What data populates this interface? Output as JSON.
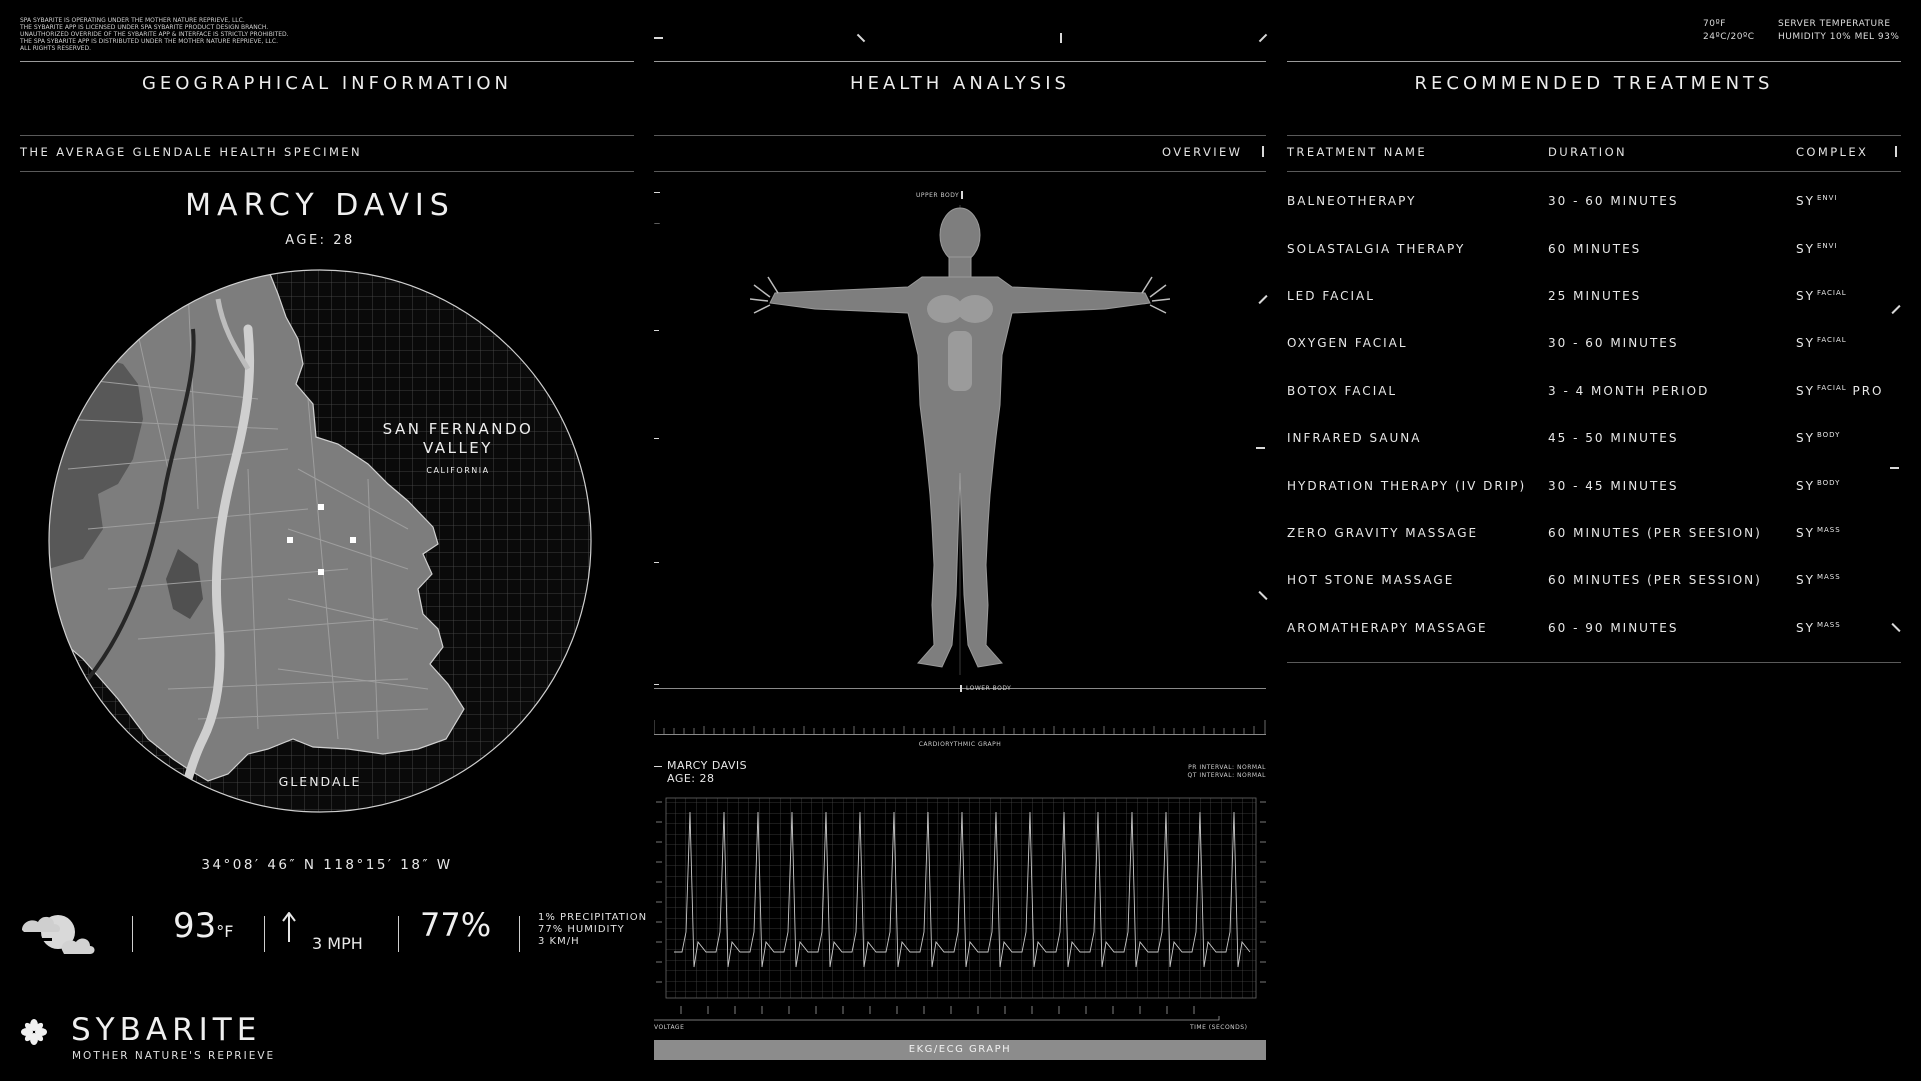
{
  "legal_lines": [
    "SPA SYBARITE IS OPERATING UNDER THE MOTHER NATURE REPRIEVE, LLC.",
    "THE SYBARITE APP IS LICENSED UNDER SPA SYBARITE PRODUCT DESIGN BRANCH.",
    "UNAUTHORIZED OVERRIDE OF THE SYBARITE APP & INTERFACE IS STRICTLY PROHIBITED.",
    "THE SPA SYBARITE APP IS DISTRIBUTED UNDER THE MOTHER NATURE REPRIEVE, LLC.",
    "ALL RIGHTS RESERVED."
  ],
  "server": {
    "temp_f": "70ºF",
    "temp_c": "24ºC/20ºC",
    "label": "SERVER TEMPERATURE",
    "humidity": "HUMIDITY 10% MEL 93%"
  },
  "sections": {
    "geo": "GEOGRAPHICAL INFORMATION",
    "health": "HEALTH ANALYSIS",
    "treatments": "RECOMMENDED TREATMENTS"
  },
  "geo": {
    "subtitle": "THE AVERAGE GLENDALE HEALTH SPECIMEN",
    "name": "MARCY DAVIS",
    "age": "AGE: 28",
    "region": "SAN FERNANDO",
    "region2": "VALLEY",
    "state": "CALIFORNIA",
    "city": "GLENDALE",
    "coords": "34°08′ 46″ N 118°15′ 18″ W"
  },
  "weather": {
    "temp": "93",
    "unit": "°F",
    "wind": "3 MPH",
    "humidity_big": "77%",
    "precip": "1% PRECIPITATION",
    "humidity": "77% HUMIDITY",
    "wind_kmh": "3 KM/H"
  },
  "brand": {
    "name": "SYBARITE",
    "tagline": "MOTHER NATURE'S REPRIEVE"
  },
  "health": {
    "overview": "OVERVIEW",
    "upper": "UPPER BODY",
    "lower": "LOWER BODY",
    "graph_title": "CARDIORYTHMIC GRAPH",
    "patient_name": "MARCY DAVIS",
    "patient_age": "AGE: 28",
    "pr": "PR INTERVAL: NORMAL",
    "qt": "QT INTERVAL: NORMAL",
    "x_label_left": "VOLTAGE",
    "x_label_right": "TIME (SECONDS)",
    "button": "EKG/ECG GRAPH"
  },
  "treatments": {
    "headers": [
      "TREATMENT NAME",
      "DURATION",
      "COMPLEX"
    ],
    "rows": [
      {
        "name": "BALNEOTHERAPY",
        "duration": "30 - 60 MINUTES",
        "sy": "SY",
        "sup": "ENVI",
        "extra": ""
      },
      {
        "name": "SOLASTALGIA THERAPY",
        "duration": "60 MINUTES",
        "sy": "SY",
        "sup": "ENVI",
        "extra": ""
      },
      {
        "name": "LED FACIAL",
        "duration": "25 MINUTES",
        "sy": "SY",
        "sup": "FACIAL",
        "extra": ""
      },
      {
        "name": "OXYGEN FACIAL",
        "duration": "30 - 60 MINUTES",
        "sy": "SY",
        "sup": "FACIAL",
        "extra": ""
      },
      {
        "name": "BOTOX FACIAL",
        "duration": "3 - 4 MONTH PERIOD",
        "sy": "SY",
        "sup": "FACIAL",
        "extra": "PRO"
      },
      {
        "name": "INFRARED SAUNA",
        "duration": "45 - 50 MINUTES",
        "sy": "SY",
        "sup": "BODY",
        "extra": ""
      },
      {
        "name": "HYDRATION THERAPY (IV DRIP)",
        "duration": "30 - 45 MINUTES",
        "sy": "SY",
        "sup": "BODY",
        "extra": ""
      },
      {
        "name": "ZERO GRAVITY MASSAGE",
        "duration": "60 MINUTES (PER SEESION)",
        "sy": "SY",
        "sup": "MASS",
        "extra": ""
      },
      {
        "name": "HOT STONE MASSAGE",
        "duration": "60 MINUTES (PER SESSION)",
        "sy": "SY",
        "sup": "MASS",
        "extra": ""
      },
      {
        "name": "AROMATHERAPY MASSAGE",
        "duration": "60 - 90 MINUTES",
        "sy": "SY",
        "sup": "MASS",
        "extra": ""
      }
    ]
  }
}
